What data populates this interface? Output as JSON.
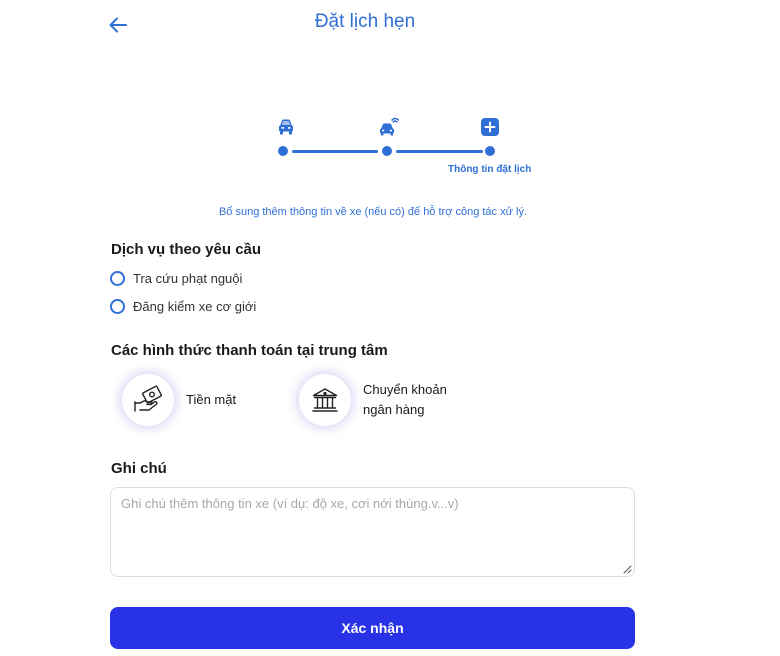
{
  "header": {
    "title": "Đặt lịch hẹn",
    "back_icon": "arrow-left-icon"
  },
  "stepper": {
    "steps": [
      {
        "icon": "car-front-icon",
        "label": ""
      },
      {
        "icon": "car-signal-icon",
        "label": ""
      },
      {
        "icon": "plus-square-icon",
        "label": "Thông tin đặt lịch"
      }
    ],
    "active_color": "#2f6fd6"
  },
  "hint": "Bổ sung thêm thông tin về xe (nếu có) để hỗ trợ công tác xử lý.",
  "services": {
    "title": "Dịch vụ theo yêu cầu",
    "options": [
      {
        "label": "Tra cứu phạt nguội",
        "checked": false
      },
      {
        "label": "Đăng kiểm xe cơ giới",
        "checked": false
      }
    ]
  },
  "payment": {
    "title": "Các hình thức thanh toán tại trung tâm",
    "options": [
      {
        "label": "Tiền mặt",
        "icon": "cash-hand-icon"
      },
      {
        "label": "Chuyển khoản ngân hàng",
        "icon": "bank-icon"
      }
    ]
  },
  "note": {
    "title": "Ghi chú",
    "value": "",
    "placeholder": "Ghi chú thêm thông tin xe (ví dụ: độ xe, cơi nới thùng.v...v)"
  },
  "submit_label": "Xác nhận",
  "colors": {
    "primary": "#2f6fd6",
    "button": "#2832e6"
  }
}
